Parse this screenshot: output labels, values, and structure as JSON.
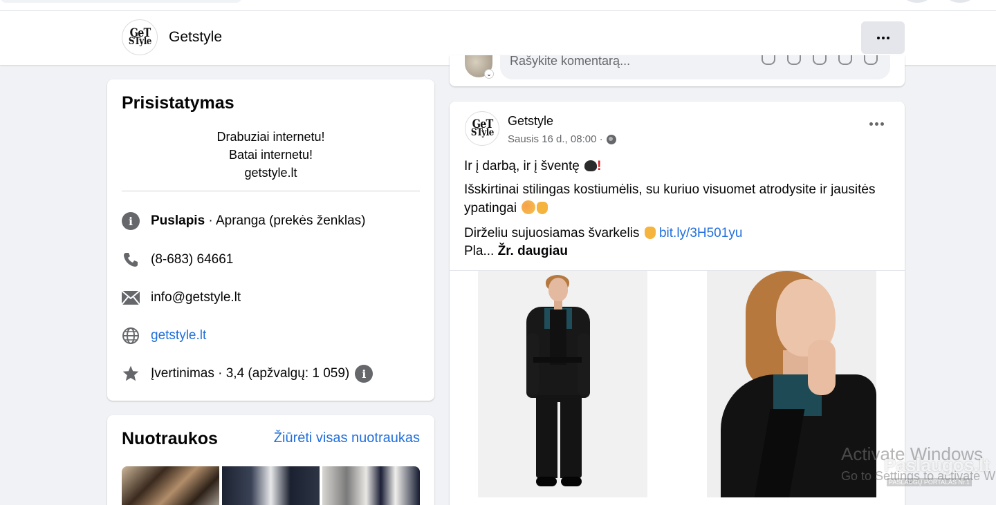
{
  "header": {
    "page_name": "Getstyle",
    "logo_line1": "GeT",
    "logo_line2": "STyle",
    "more_label": ""
  },
  "intro": {
    "title": "Prisistatymas",
    "bio_lines": [
      "Drabuziai internetu!",
      "Batai internetu!",
      "getstyle.lt"
    ],
    "page_type_label": "Puslapis",
    "page_type_value": " · Apranga (prekės ženklas)",
    "phone": "(8-683) 64661",
    "email": "info@getstyle.lt",
    "website": "getstyle.lt",
    "rating": "Įvertinimas · 3,4 (apžvalgų: 1 059)"
  },
  "photos": {
    "title": "Nuotraukos",
    "see_all": "Žiūrėti visas nuotraukas"
  },
  "comment": {
    "placeholder": "Rašykite komentarą..."
  },
  "post": {
    "author": "Getstyle",
    "date": "Sausis 16 d., 08:00 ·",
    "line1": "Ir į darbą, ir į šventę",
    "line2": "Išskirtinai stilingas kostiumėlis, su kuriuo visuomet atrodysite ir jausitės ypatingai",
    "line3": "Dirželiu sujuosiamas švarkelis",
    "link": "bit.ly/3H501yu",
    "line4": "Pla...",
    "see_more": "Žr. daugiau"
  },
  "watermarks": {
    "activate_title": "Activate Windows",
    "activate_sub": "Go to Settings to activate Windows.",
    "portal_logo": "Paslaugos.lt",
    "portal_sub": "PASLAUGŲ PORTALAS  Nr.1"
  },
  "colors": {
    "accent_link": "#216fdb",
    "background": "#f0f2f5",
    "icon_gray": "#65676b"
  }
}
